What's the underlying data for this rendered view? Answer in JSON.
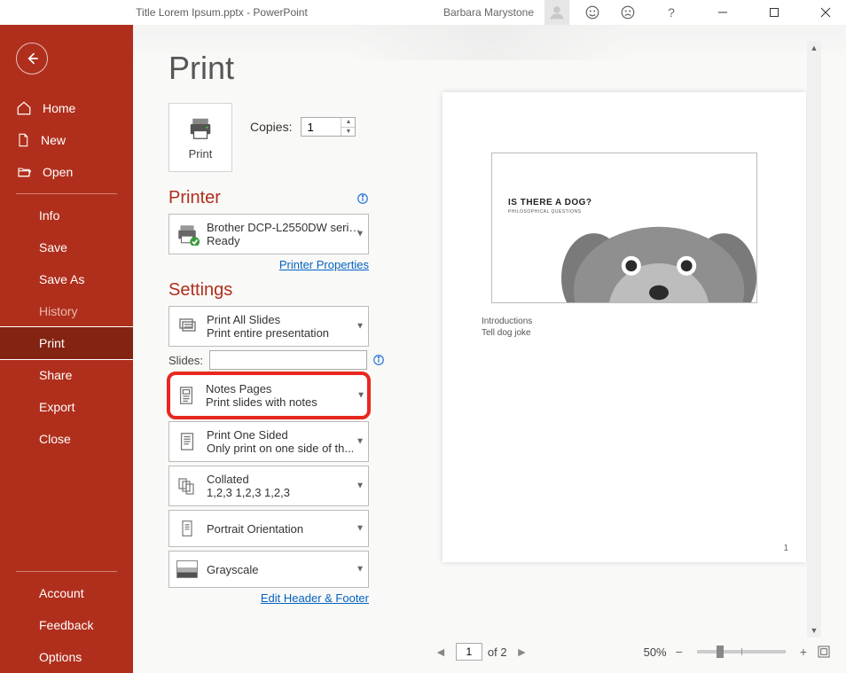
{
  "app_title": "Title Lorem Ipsum.pptx  -  PowerPoint",
  "user_name": "Barbara Marystone",
  "sidebar": {
    "top": [
      {
        "label": "Home",
        "icon": "home"
      },
      {
        "label": "New",
        "icon": "new"
      },
      {
        "label": "Open",
        "icon": "open"
      }
    ],
    "mid": [
      {
        "label": "Info"
      },
      {
        "label": "Save"
      },
      {
        "label": "Save As"
      },
      {
        "label": "History",
        "dim": true
      },
      {
        "label": "Print",
        "selected": true
      },
      {
        "label": "Share"
      },
      {
        "label": "Export"
      },
      {
        "label": "Close"
      }
    ],
    "bottom": [
      {
        "label": "Account"
      },
      {
        "label": "Feedback"
      },
      {
        "label": "Options"
      }
    ]
  },
  "page_heading": "Print",
  "print_button_label": "Print",
  "copies": {
    "label": "Copies:",
    "value": "1"
  },
  "printer_heading": "Printer",
  "printer": {
    "name": "Brother DCP-L2550DW serie...",
    "status": "Ready"
  },
  "printer_properties_link": "Printer Properties",
  "settings_heading": "Settings",
  "slides_label": "Slides:",
  "settings_items": [
    {
      "id": "print-all",
      "title": "Print All Slides",
      "sub": "Print entire presentation"
    },
    {
      "id": "notes-pages",
      "title": "Notes Pages",
      "sub": "Print slides with notes",
      "highlight": true
    },
    {
      "id": "one-sided",
      "title": "Print One Sided",
      "sub": "Only print on one side of th..."
    },
    {
      "id": "collated",
      "title": "Collated",
      "sub": "1,2,3    1,2,3    1,2,3"
    },
    {
      "id": "orientation",
      "title": "Portrait Orientation",
      "sub": ""
    },
    {
      "id": "color",
      "title": "Grayscale",
      "sub": ""
    }
  ],
  "edit_header_footer_link": "Edit Header & Footer",
  "preview": {
    "slide_title": "IS THERE A DOG?",
    "slide_subtitle": "PHILOSOPHICAL QUESTIONS",
    "notes": [
      "Introductions",
      "Tell dog joke"
    ],
    "page_number": "1",
    "nav": {
      "current": "1",
      "of": "of 2"
    },
    "zoom": "50%"
  }
}
